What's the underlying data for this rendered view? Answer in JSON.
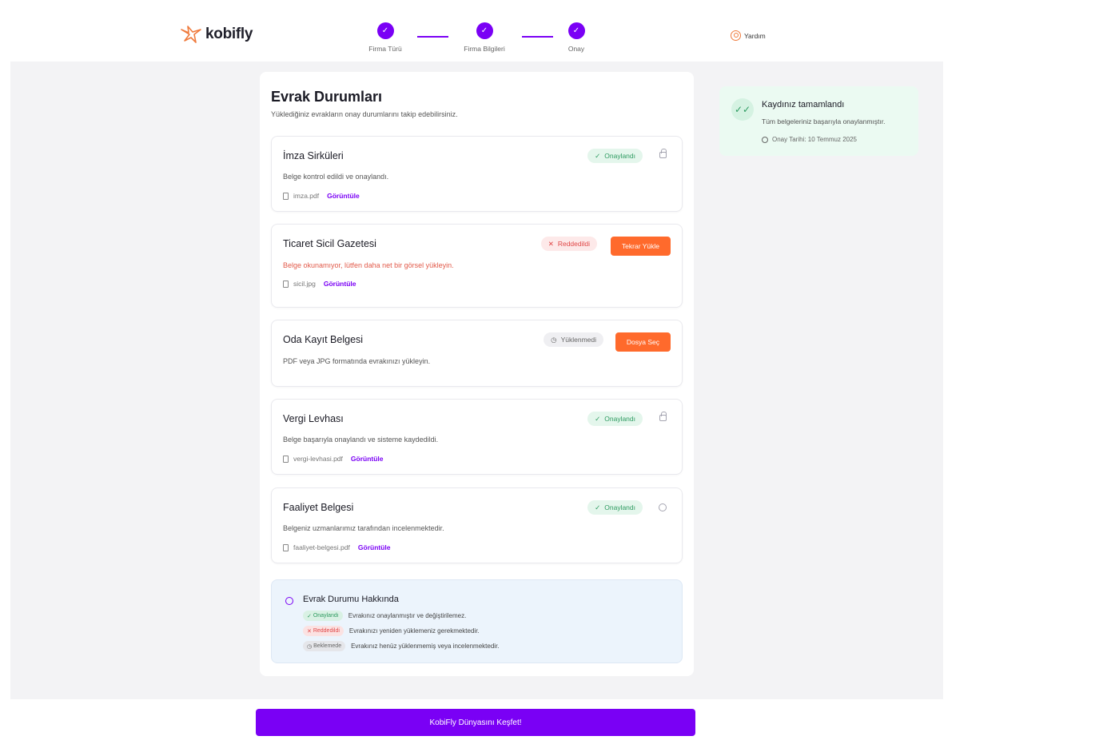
{
  "brand": {
    "name": "kobifly",
    "accent": "#7a00f5",
    "logo_color": "#ef7a3c"
  },
  "steps": [
    {
      "label": "Firma Türü",
      "status": "completed"
    },
    {
      "label": "Firma Bilgileri",
      "status": "completed"
    },
    {
      "label": "Onay",
      "status": "completed"
    }
  ],
  "header": {
    "help_label": "Yardım"
  },
  "page": {
    "title": "Evrak Durumları",
    "subtitle": "Yüklediğiniz evrakların onay durumlarını takip edebilirsiniz."
  },
  "documents": [
    {
      "title": "İmza Sirküleri",
      "status": "Onaylandı",
      "status_type": "approved",
      "description": "Belge kontrol edildi ve onaylandı.",
      "file": "imza.pdf",
      "view_label": "Görüntüle",
      "trailing_icon": "lock-icon"
    },
    {
      "title": "Ticaret Sicil Gazetesi",
      "status": "Reddedildi",
      "status_type": "rejected",
      "description": "Belge okunamıyor, lütfen daha net bir görsel yükleyin.",
      "file": "sicil.jpg",
      "view_label": "Görüntüle",
      "action": "Tekrar Yükle"
    },
    {
      "title": "Oda Kayıt Belgesi",
      "status": "Yüklenmedi",
      "status_type": "missing",
      "description": "PDF veya JPG formatında evrakınızı yükleyin.",
      "action": "Dosya Seç"
    },
    {
      "title": "Vergi Levhası",
      "status": "Onaylandı",
      "status_type": "approved",
      "description": "Belge başarıyla onaylandı ve sisteme kaydedildi.",
      "file": "vergi-levhasi.pdf",
      "view_label": "Görüntüle",
      "trailing_icon": "lock-icon"
    },
    {
      "title": "Faaliyet Belgesi",
      "status": "Onaylandı",
      "status_type": "approved",
      "description": "Belgeniz uzmanlarımız tarafından incelenmektedir.",
      "file": "faaliyet-belgesi.pdf",
      "view_label": "Görüntüle",
      "trailing_icon": "clock-icon"
    }
  ],
  "info": {
    "title": "Evrak Durumu Hakkında",
    "legend": [
      {
        "badge": "Onaylandı",
        "type": "ok",
        "text": "Evrakınız onaylanmıştır ve değiştirilemez."
      },
      {
        "badge": "Reddedildi",
        "type": "bad",
        "text": "Evrakınızı yeniden yüklemeniz gerekmektedir."
      },
      {
        "badge": "Beklemede",
        "type": "wait",
        "text": "Evrakınız henüz yüklenmemiş veya incelenmektedir."
      }
    ]
  },
  "side": {
    "title": "Kaydınız tamamlandı",
    "text": "Tüm belgeleriniz başarıyla onaylanmıştır.",
    "date": "Onay Tarihi: 10 Temmuz 2025"
  },
  "cta": {
    "label": "KobiFly Dünyasını Keşfet!"
  }
}
